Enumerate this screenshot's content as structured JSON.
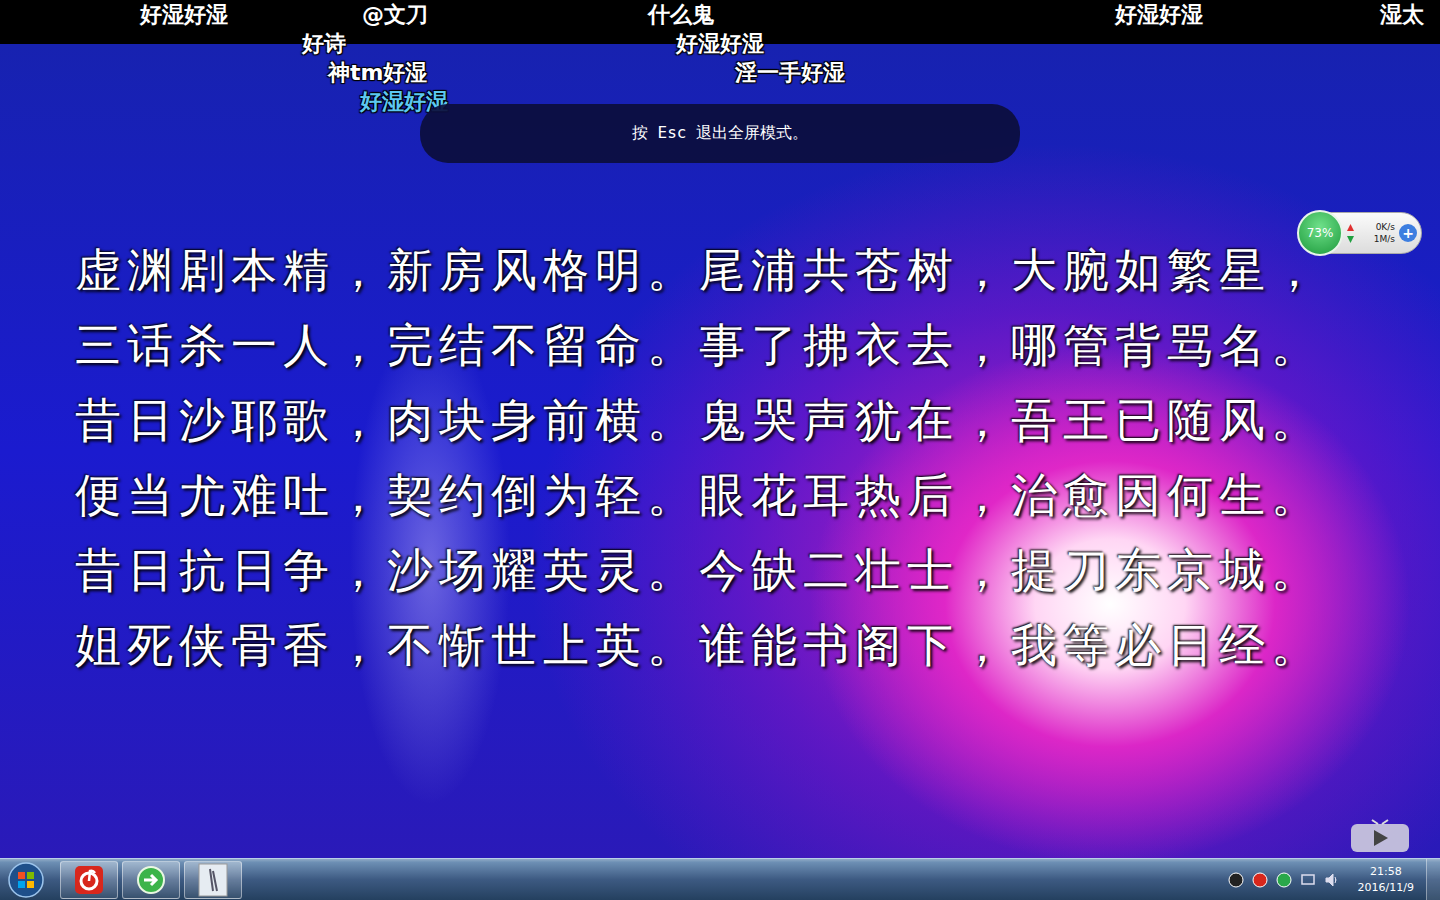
{
  "danmaku": [
    {
      "text": "好湿好湿",
      "color": "#ffffff"
    },
    {
      "text": "@文刀",
      "color": "#ffffff"
    },
    {
      "text": "什么鬼",
      "color": "#ffffff"
    },
    {
      "text": "好湿好湿",
      "color": "#ffffff"
    },
    {
      "text": "湿太",
      "color": "#ffffff"
    },
    {
      "text": "好诗",
      "color": "#ffffff"
    },
    {
      "text": "好湿好湿",
      "color": "#ffffff"
    },
    {
      "text": "神tm好湿",
      "color": "#ffffff"
    },
    {
      "text": "淫一手好湿",
      "color": "#ffffff"
    },
    {
      "text": "好湿好湿",
      "color": "#5cc8f0"
    }
  ],
  "fullscreen_notice": "按 Esc 退出全屏模式。",
  "poem": {
    "lines": [
      "虚渊剧本精，新房风格明。尾浦共苍树，大腕如繁星，",
      "三话杀一人，完结不留命。事了拂衣去，哪管背骂名。",
      "昔日沙耶歌，肉块身前横。鬼哭声犹在，吾王已随风。",
      "便当尤难吐，契约倒为轻。眼花耳热后，治愈因何生。",
      "昔日抗日争，沙场耀英灵。今缺二壮士，提刀东京城。",
      "姐死侠骨香，不惭世上英。谁能书阁下，我等必日经。"
    ]
  },
  "net_widget": {
    "percent": "73%",
    "upload": "0K/s",
    "download": "1M/s",
    "add": "+"
  },
  "taskbar": {
    "apps": [
      {
        "kind": "music",
        "selected": false
      },
      {
        "kind": "browser",
        "selected": false
      },
      {
        "kind": "image",
        "selected": false
      }
    ],
    "tray": [
      {
        "kind": "qq"
      },
      {
        "kind": "netease"
      },
      {
        "kind": "guard"
      },
      {
        "kind": "network"
      },
      {
        "kind": "volume"
      }
    ],
    "clock": {
      "time": "21:58",
      "date": "2016/11/9"
    }
  }
}
